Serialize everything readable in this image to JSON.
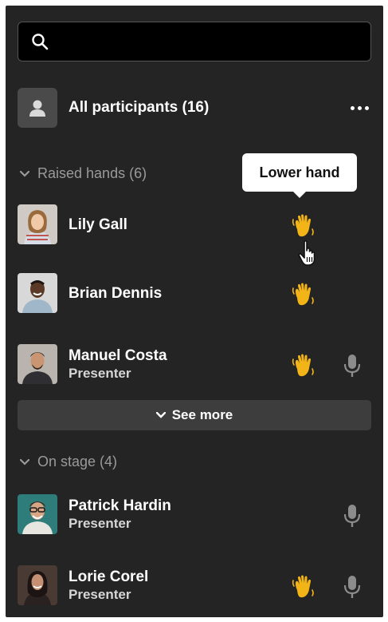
{
  "search": {
    "placeholder": ""
  },
  "all_participants": {
    "label": "All participants (16)",
    "more_icon": "more-horizontal-icon"
  },
  "raised_hands": {
    "header": "Raised hands (6)",
    "people": [
      {
        "name": "Lily Gall",
        "role": "",
        "hand_raised": true,
        "mic": false
      },
      {
        "name": "Brian Dennis",
        "role": "",
        "hand_raised": true,
        "mic": false
      },
      {
        "name": "Manuel Costa",
        "role": "Presenter",
        "hand_raised": true,
        "mic": true
      }
    ],
    "see_more_label": "See more"
  },
  "on_stage": {
    "header": "On stage (4)",
    "people": [
      {
        "name": "Patrick Hardin",
        "role": "Presenter",
        "hand_raised": false,
        "mic": true
      },
      {
        "name": "Lorie Corel",
        "role": "Presenter",
        "hand_raised": true,
        "mic": true
      }
    ]
  },
  "tooltip": {
    "label": "Lower hand"
  },
  "colors": {
    "panel_bg": "#242424",
    "hand": "#f2b417",
    "mic": "#8c8c8c",
    "button_bg": "#3d3d3d"
  },
  "icons": [
    "search-icon",
    "person-icon",
    "chevron-down-icon",
    "hand-wave-icon",
    "microphone-icon",
    "pointer-cursor-icon"
  ]
}
